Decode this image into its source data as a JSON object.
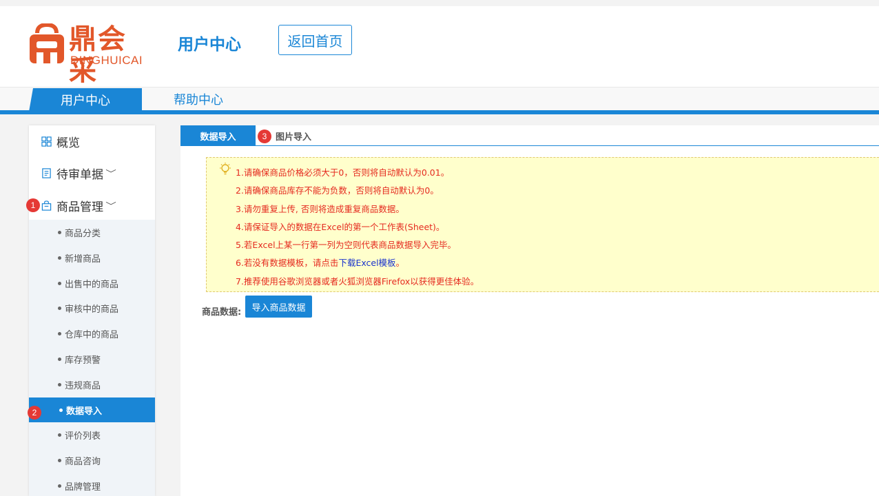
{
  "logo": {
    "main": "鼎会采",
    "sub": "DINGHUICAI"
  },
  "header": {
    "title": "用户中心",
    "home_button": "返回首页"
  },
  "nav": {
    "tabs": [
      "用户中心",
      "帮助中心"
    ]
  },
  "sidebar": {
    "main_items": [
      {
        "label": "概览",
        "icon": "grid-icon"
      },
      {
        "label": "待审单据",
        "icon": "document-icon",
        "chevron": "﹀"
      },
      {
        "label": "商品管理",
        "icon": "bag-icon",
        "chevron": "﹀"
      }
    ],
    "sub_items": [
      "商品分类",
      "新增商品",
      "出售中的商品",
      "审核中的商品",
      "仓库中的商品",
      "库存预警",
      "违规商品",
      "数据导入",
      "评价列表",
      "商品咨询",
      "品牌管理"
    ],
    "active_sub": "数据导入"
  },
  "badges": [
    "1",
    "2",
    "3"
  ],
  "main": {
    "tabs": [
      "数据导入",
      "图片导入"
    ],
    "notice": [
      "1.请确保商品价格必须大于0，否则将自动默认为0.01。",
      "2.请确保商品库存不能为负数，否则将自动默认为0。",
      "3.请勿重复上传, 否则将造成重复商品数据。",
      "4.请保证导入的数据在Excel的第一个工作表(Sheet)。",
      "5.若Excel上某一行第一列为空则代表商品数据导入完毕。",
      "6.若没有数据模板，请点击",
      "7.推荐使用谷歌浏览器或者火狐浏览器Firefox以获得更佳体验。"
    ],
    "notice_link": "下载Excel模板",
    "notice_tail": "。",
    "upload_label": "商品数据:",
    "upload_button": "导入商品数据"
  },
  "colors": {
    "primary": "#1a86d6",
    "brand": "#e2572a",
    "notice_bg": "#ffffcc",
    "notice_text": "#e52a1f",
    "badge": "#e53935"
  }
}
